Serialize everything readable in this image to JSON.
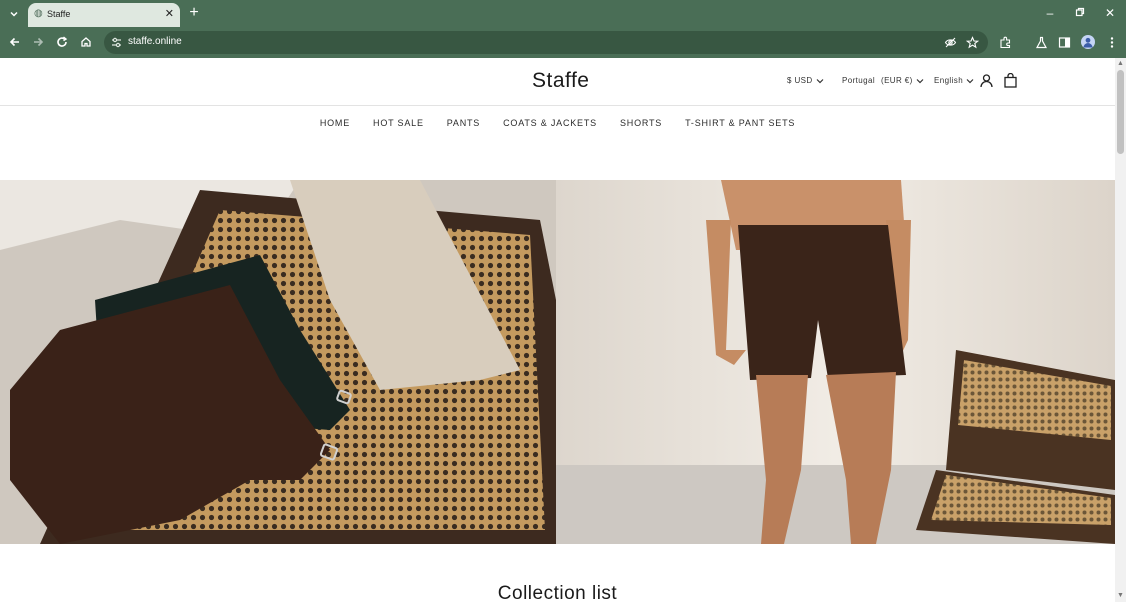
{
  "browser": {
    "tab_title": "Staffe",
    "url": "staffe.online"
  },
  "store": {
    "brand": "Staffe",
    "currency": "$ USD",
    "country": "Portugal",
    "country_currency": "(EUR €)",
    "language": "English"
  },
  "menu": {
    "items": [
      "HOME",
      "HOT SALE",
      "PANTS",
      "COATS & JACKETS",
      "SHORTS",
      "T-SHIRT & PANT SETS"
    ]
  },
  "sections": {
    "collection_title": "Collection list"
  },
  "colors": {
    "chrome": "#4a6e56",
    "omnibox": "#385742",
    "text": "#1a1a1a"
  }
}
